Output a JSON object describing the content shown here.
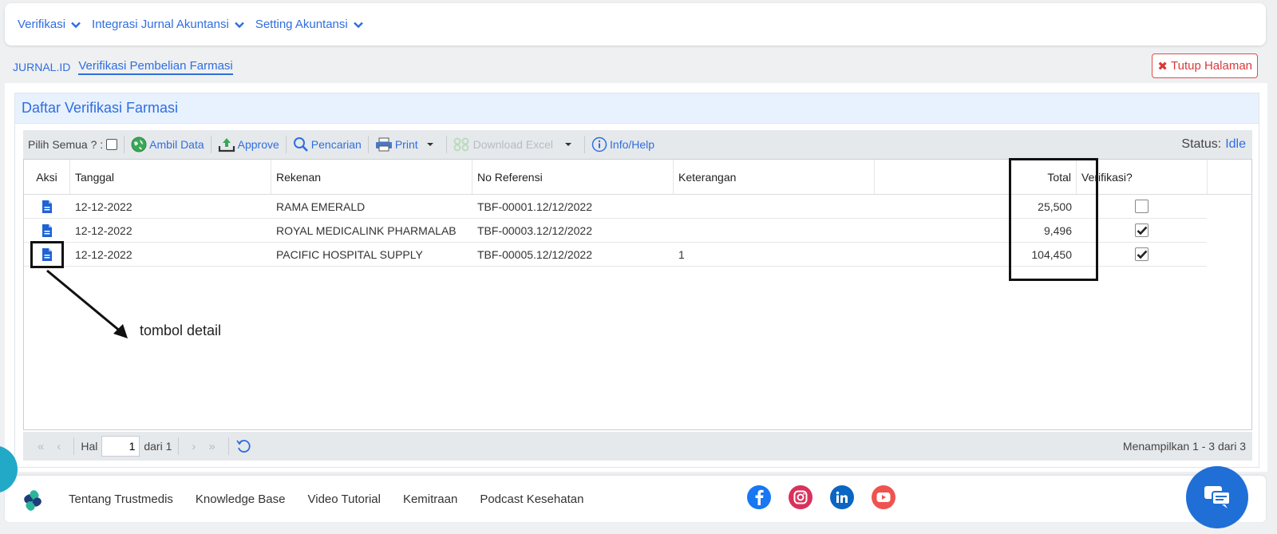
{
  "nav": {
    "items": [
      {
        "label": "Verifikasi"
      },
      {
        "label": "Integrasi Jurnal Akuntansi"
      },
      {
        "label": "Setting Akuntansi"
      }
    ]
  },
  "breadcrumb": {
    "root": "JURNAL.ID",
    "current": "Verifikasi Pembelian Farmasi"
  },
  "close_button": "Tutup Halaman",
  "panel": {
    "title": "Daftar Verifikasi Farmasi"
  },
  "toolbar": {
    "select_all_label": "Pilih Semua ? :",
    "ambil_data": "Ambil Data",
    "approve": "Approve",
    "pencarian": "Pencarian",
    "print": "Print",
    "download_excel": "Download Excel",
    "info_help": "Info/Help",
    "status_label": "Status:",
    "status_value": "Idle"
  },
  "table": {
    "headers": {
      "aksi": "Aksi",
      "tanggal": "Tanggal",
      "rekenan": "Rekenan",
      "no_referensi": "No Referensi",
      "keterangan": "Keterangan",
      "total": "Total",
      "verifikasi": "Verifikasi?"
    },
    "rows": [
      {
        "tanggal": "12-12-2022",
        "rekenan": "RAMA EMERALD",
        "no_referensi": "TBF-00001.12/12/2022",
        "keterangan": "",
        "total": "25,500",
        "verified": false
      },
      {
        "tanggal": "12-12-2022",
        "rekenan": "ROYAL MEDICALINK PHARMALAB",
        "no_referensi": "TBF-00003.12/12/2022",
        "keterangan": "",
        "total": "9,496",
        "verified": true
      },
      {
        "tanggal": "12-12-2022",
        "rekenan": "PACIFIC HOSPITAL SUPPLY",
        "no_referensi": "TBF-00005.12/12/2022",
        "keterangan": "1",
        "total": "104,450",
        "verified": true
      }
    ]
  },
  "pager": {
    "hal_label": "Hal",
    "page": "1",
    "of_label": "dari 1",
    "info": "Menampilkan 1 - 3 dari 3"
  },
  "annotation": {
    "text": "tombol detail"
  },
  "footer": {
    "links": [
      "Tentang Trustmedis",
      "Knowledge Base",
      "Video Tutorial",
      "Kemitraan",
      "Podcast Kesehatan"
    ]
  },
  "socials": [
    {
      "icon": "facebook-icon",
      "color": "#1877f2"
    },
    {
      "icon": "instagram-icon",
      "color": "#e1306c"
    },
    {
      "icon": "linkedin-icon",
      "color": "#0a66c2"
    },
    {
      "icon": "youtube-icon",
      "color": "#ef4b4b"
    }
  ],
  "colors": {
    "accent": "#2f6ee0",
    "danger": "#d93a3a",
    "chat": "#1f6fd6"
  }
}
